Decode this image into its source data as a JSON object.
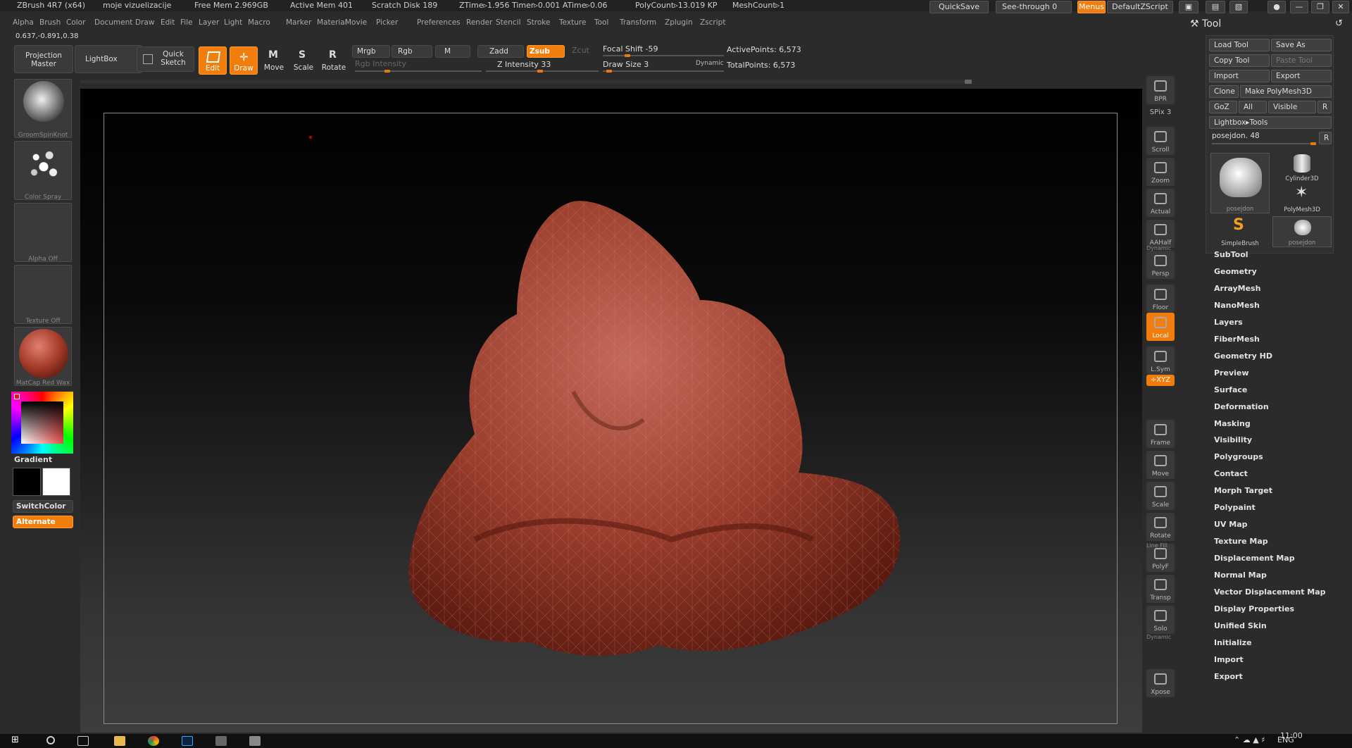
{
  "titlebar": {
    "app": "ZBrush 4R7 (x64)",
    "doc": "moje vizuelizacije",
    "free_mem": "Free Mem 2.969GB",
    "active_mem": "Active Mem 401",
    "scratch": "Scratch Disk 189",
    "ztime": "ZTime▹1.956 Timer▹0.001 ATime▹0.06",
    "polycount": "PolyCount▹13.019 KP",
    "meshcount": "MeshCount▹1",
    "quicksave": "QuickSave",
    "seethrough": "See-through",
    "seethrough_value": "0",
    "menus": "Menus",
    "defaultzscript": "DefaultZScript"
  },
  "menubar": [
    "Alpha",
    "Brush",
    "Color",
    "Document",
    "Draw",
    "Edit",
    "File",
    "Layer",
    "Light",
    "Macro",
    "Marker",
    "Material",
    "Movie",
    "Picker",
    "Preferences",
    "Render",
    "Stencil",
    "Stroke",
    "Texture",
    "Tool",
    "Transform",
    "Zplugin",
    "Zscript"
  ],
  "coords": "0.637,-0.891,0.38",
  "toolbar": {
    "projection_master": "Projection Master",
    "lightbox": "LightBox",
    "quick_sketch": "Quick Sketch",
    "edit": "Edit",
    "draw": "Draw",
    "move": "Move",
    "scale": "Scale",
    "rotate": "Rotate",
    "mrgb": "Mrgb",
    "rgb": "Rgb",
    "m": "M",
    "rgb_intensity": "Rgb Intensity",
    "zadd": "Zadd",
    "zsub": "Zsub",
    "zcut": "Zcut",
    "z_intensity": "Z Intensity 33",
    "z_intensity_value": 33,
    "focal_shift": "Focal Shift -59",
    "focal_shift_value": -59,
    "draw_size": "Draw Size 3",
    "draw_size_value": 3,
    "dynamic": "Dynamic",
    "active_points": "ActivePoints: 6,573",
    "total_points": "TotalPoints: 6,573"
  },
  "leftshelf": {
    "brush": "GroomSpinKnot",
    "stroke": "Color Spray",
    "alpha": "Alpha Off",
    "texture": "Texture Off",
    "material": "MatCap Red Wax",
    "gradient": "Gradient",
    "switchcolor": "SwitchColor",
    "alternate": "Alternate"
  },
  "rightshelf": {
    "bpr": "BPR",
    "spix": "SPix 3",
    "spix_value": 3,
    "scroll": "Scroll",
    "zoom": "Zoom",
    "actual": "Actual",
    "aahalf": "AAHalf",
    "dynamic": "Dynamic",
    "persp": "Persp",
    "floor": "Floor",
    "local": "Local",
    "lsym": "L.Sym",
    "xyz": "÷XYZ",
    "frame": "Frame",
    "move": "Move",
    "scale": "Scale",
    "rotate": "Rotate",
    "linefill": "Line Fill",
    "polyf": "PolyF",
    "transp": "Transp",
    "dynamic2": "Dynamic",
    "solo": "Solo",
    "xpose": "Xpose"
  },
  "toolpanel": {
    "title": "Tool",
    "load_tool": "Load Tool",
    "save_as": "Save As",
    "copy_tool": "Copy Tool",
    "paste_tool": "Paste Tool",
    "import": "Import",
    "export": "Export",
    "clone": "Clone",
    "make_polymesh": "Make PolyMesh3D",
    "goz": "GoZ",
    "all": "All",
    "visible": "Visible",
    "r": "R",
    "lightbox_tools": "Lightbox▸Tools",
    "current_tool": "posejdon. 48",
    "current_tool_value": 48,
    "thumbs": [
      "posejdon",
      "Cylinder3D",
      "PolyMesh3D",
      "SimpleBrush",
      "posejdon"
    ],
    "menu": [
      "SubTool",
      "Geometry",
      "ArrayMesh",
      "NanoMesh",
      "Layers",
      "FiberMesh",
      "Geometry HD",
      "Preview",
      "Surface",
      "Deformation",
      "Masking",
      "Visibility",
      "Polygroups",
      "Contact",
      "Morph Target",
      "Polypaint",
      "UV Map",
      "Texture Map",
      "Displacement Map",
      "Normal Map",
      "Vector Displacement Map",
      "Display Properties",
      "Unified Skin",
      "Initialize",
      "Import",
      "Export"
    ]
  },
  "taskbar": {
    "time": "11:00",
    "lang": "ENG"
  }
}
